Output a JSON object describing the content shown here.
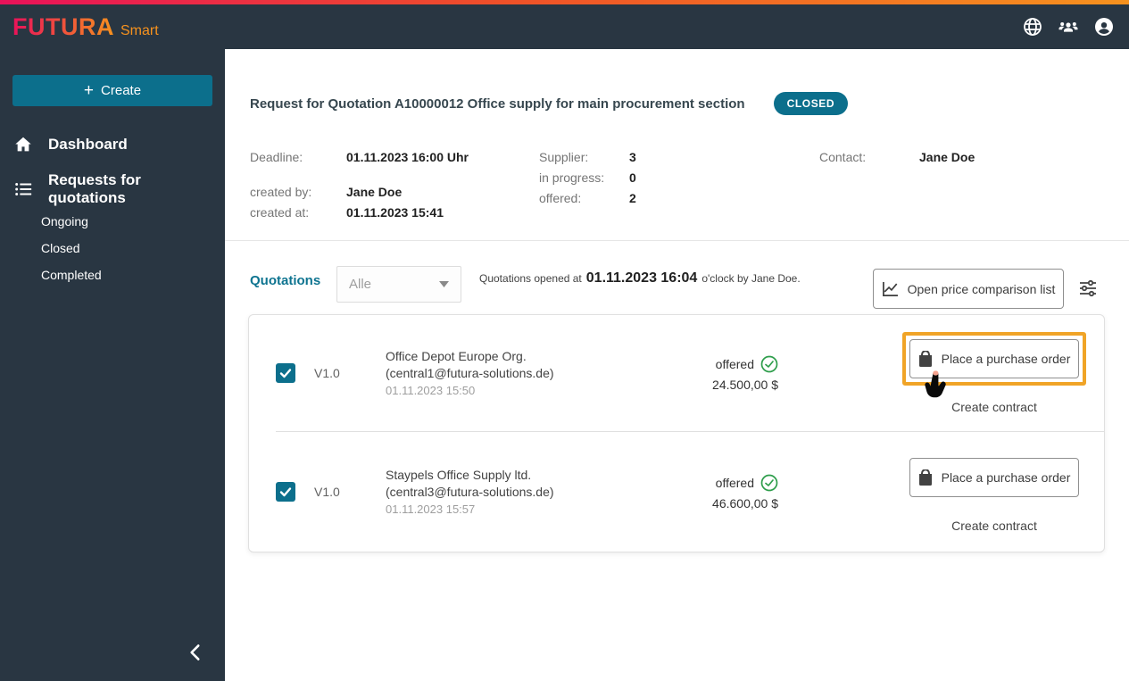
{
  "brand": {
    "name": "FUTURA",
    "suffix": "Smart"
  },
  "header": {
    "icons": [
      "globe-icon",
      "groups-icon",
      "account-circle-icon"
    ]
  },
  "sidebar": {
    "create_plus": "+",
    "create_label": "Create",
    "items": [
      {
        "label": "Dashboard",
        "icon": "home-icon"
      },
      {
        "label": "Requests for quotations",
        "icon": "list-icon"
      }
    ],
    "subitems": [
      {
        "label": "Ongoing"
      },
      {
        "label": "Closed"
      },
      {
        "label": "Completed"
      }
    ]
  },
  "page": {
    "title": "Request for Quotation A10000012 Office supply for main procurement section",
    "status_badge": "CLOSED",
    "details": {
      "deadline_label": "Deadline:",
      "deadline_value": "01.11.2023 16:00 Uhr",
      "created_by_label": "created by:",
      "created_by_value": "Jane Doe",
      "created_at_label": "created at:",
      "created_at_value": "01.11.2023 15:41",
      "supplier_label": "Supplier:",
      "supplier_value": "3",
      "in_progress_label": "in progress:",
      "in_progress_value": "0",
      "offered_label": "offered:",
      "offered_value": "2",
      "contact_label": "Contact:",
      "contact_value": "Jane Doe"
    }
  },
  "quotations": {
    "section_label": "Quotations",
    "filter_value": "Alle",
    "opened_prefix": "Quotations opened at",
    "opened_time": "01.11.2023 16:04",
    "opened_suffix": "o'clock by Jane Doe.",
    "price_comparison_label": "Open price comparison list",
    "rows": [
      {
        "version": "V1.0",
        "supplier": "Office Depot Europe Org.",
        "email": "(central1@futura-solutions.de)",
        "date": "01.11.2023 15:50",
        "status": "offered",
        "price": "24.500,00 $",
        "order_label": "Place a purchase order",
        "contract_label": "Create contract",
        "checked": true,
        "highlighted": true
      },
      {
        "version": "V1.0",
        "supplier": "Staypels Office Supply ltd.",
        "email": "(central3@futura-solutions.de)",
        "date": "01.11.2023 15:57",
        "status": "offered",
        "price": "46.600,00 $",
        "order_label": "Place a purchase order",
        "contract_label": "Create contract",
        "checked": true,
        "highlighted": false
      }
    ]
  },
  "colors": {
    "dark_header": "#293642",
    "accent_teal": "#0c6f8c",
    "teal_text": "#0e7490",
    "highlight_orange": "#f0a427",
    "status_green": "#2f9e4c",
    "gradient_start": "#e9125a",
    "gradient_end": "#f6921e"
  }
}
